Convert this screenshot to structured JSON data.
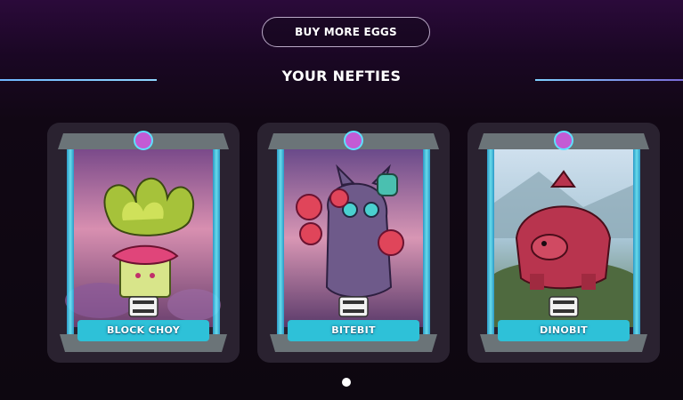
{
  "header": {
    "buy_button_label": "BUY MORE EGGS"
  },
  "section": {
    "title": "YOUR NEFTIES"
  },
  "cards": [
    {
      "name": "BLOCK CHOY"
    },
    {
      "name": "BITEBIT"
    },
    {
      "name": "DINOBIT"
    }
  ],
  "carousel": {
    "active_page": 1,
    "page_count": 1
  },
  "colors": {
    "background": "#110714",
    "frame_glow": "#3fd8f2",
    "accent_line": "#8fd6ff",
    "badge": "#c35bd4"
  }
}
